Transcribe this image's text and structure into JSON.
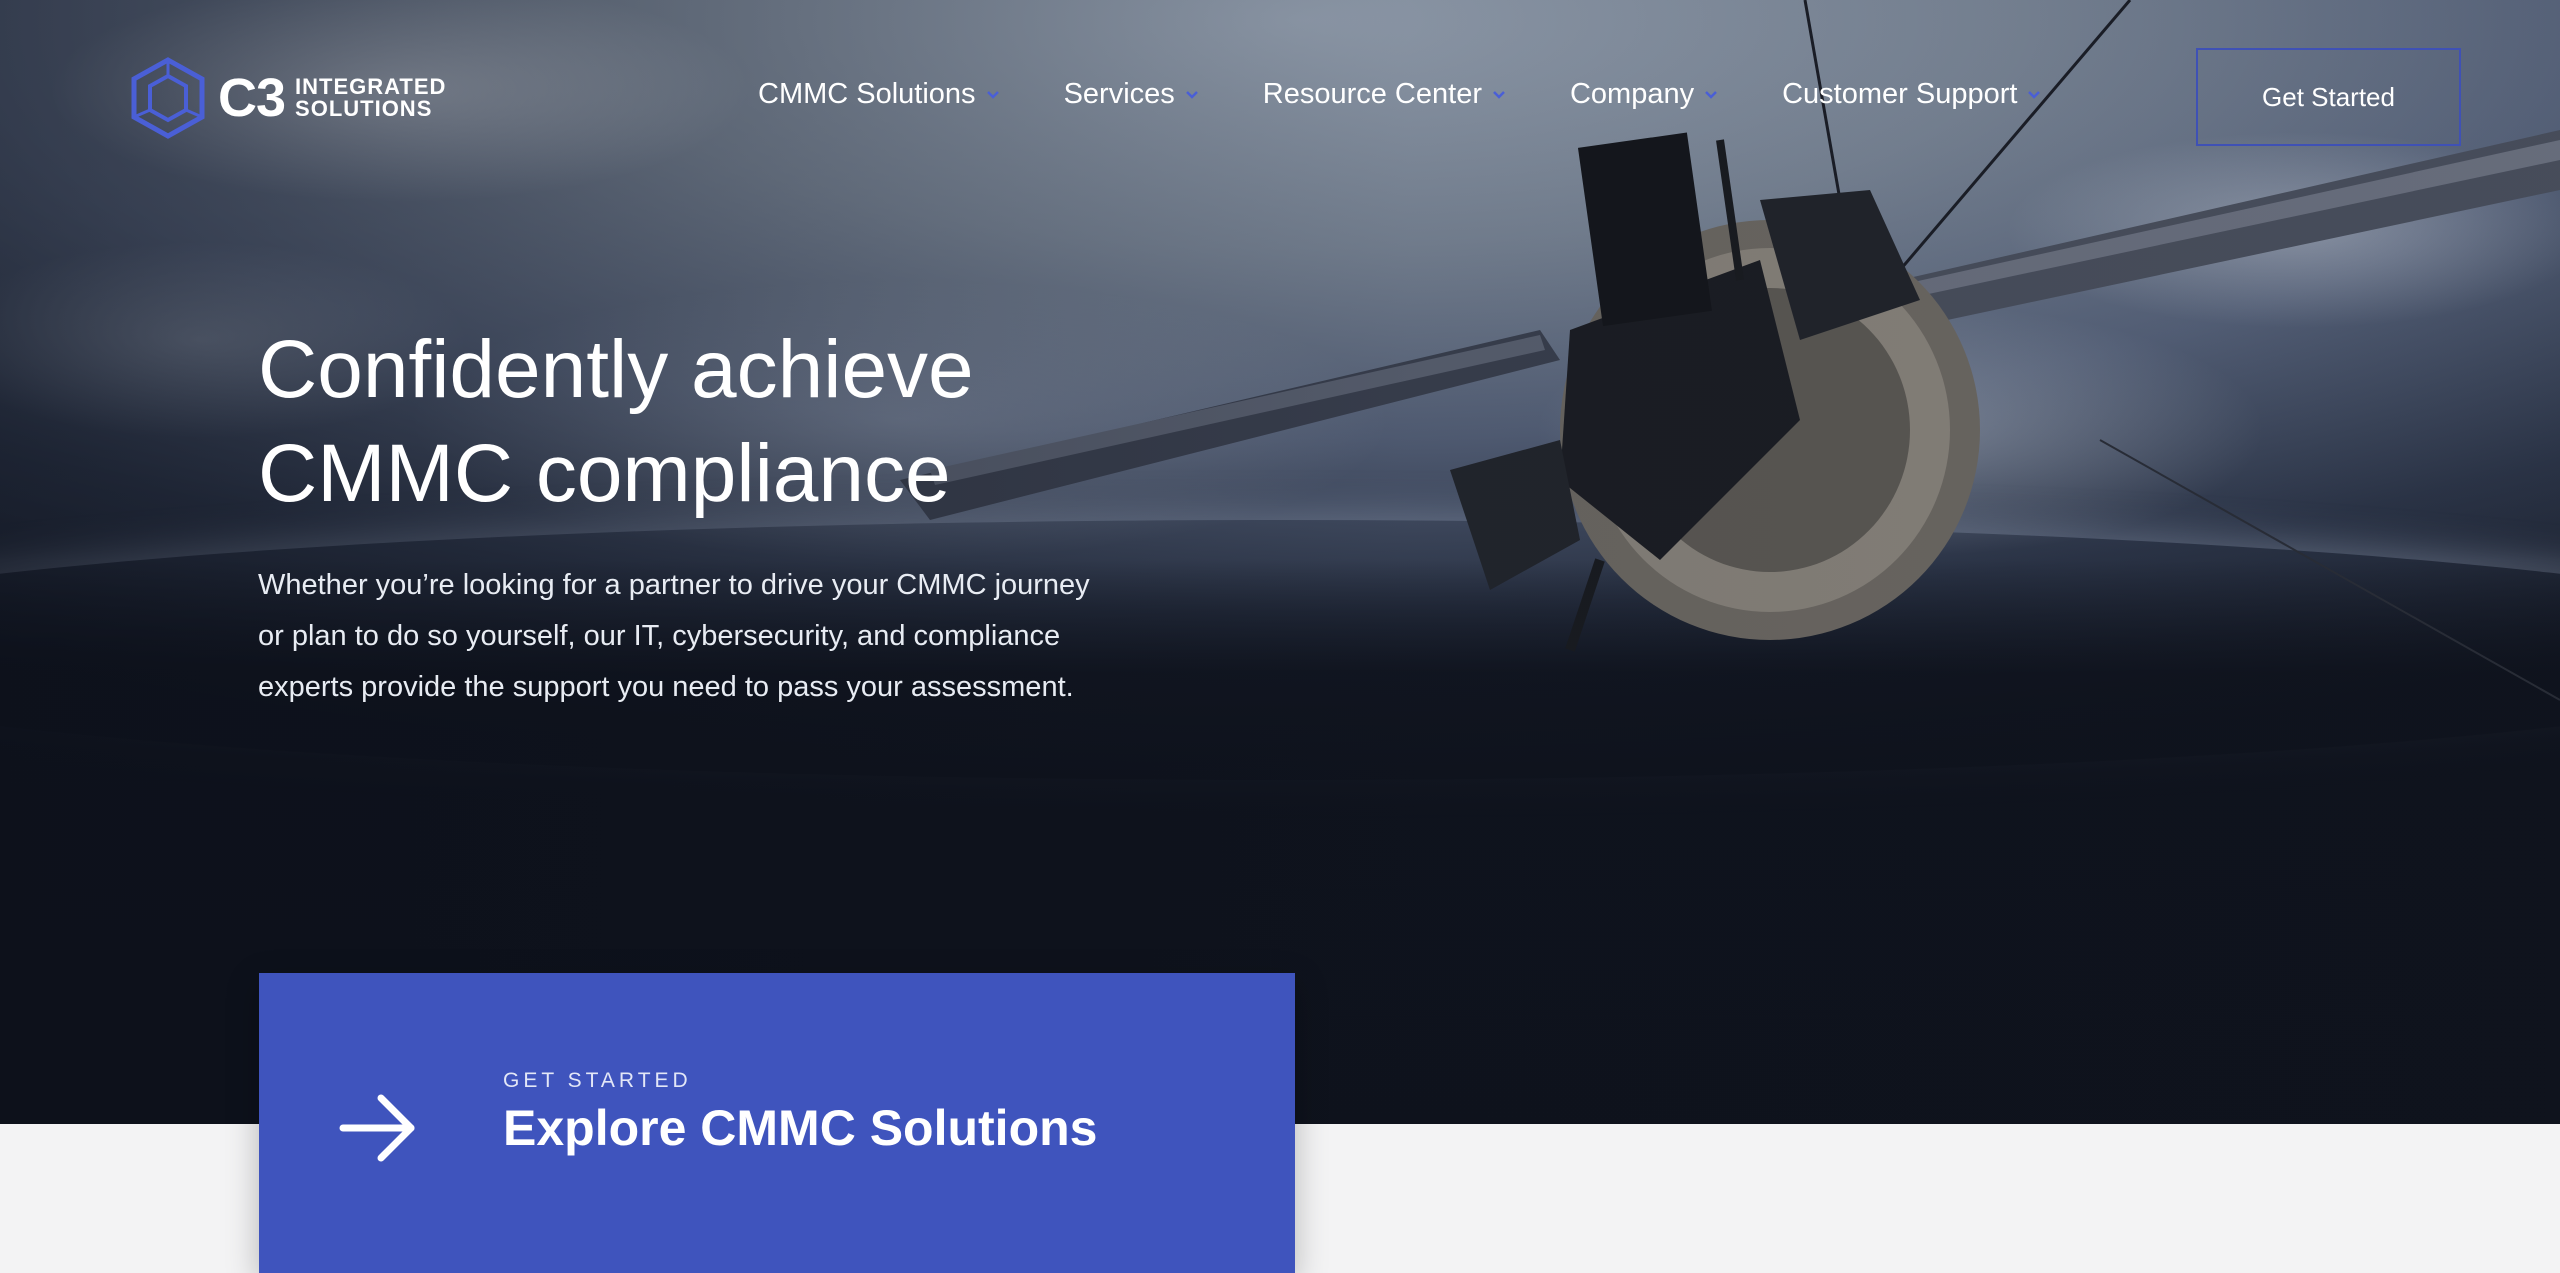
{
  "brand": {
    "mark": "C3",
    "line1": "INTEGRATED",
    "line2": "SOLUTIONS",
    "accent": "#3f51b5"
  },
  "nav": {
    "items": [
      {
        "label": "CMMC Solutions"
      },
      {
        "label": "Services"
      },
      {
        "label": "Resource Center"
      },
      {
        "label": "Company"
      },
      {
        "label": "Customer Support"
      }
    ],
    "cta_label": "Get Started"
  },
  "hero": {
    "headline_line1": "Confidently achieve",
    "headline_line2": "CMMC compliance",
    "subtext": "Whether you’re looking for a partner to drive your CMMC journey or plan to do so yourself, our IT, cybersecurity, and compliance experts provide the support you need to pass your assessment."
  },
  "card": {
    "eyebrow": "GET STARTED",
    "title": "Explore CMMC Solutions",
    "icon": "arrow-right-icon",
    "color": "#3f54bd"
  }
}
